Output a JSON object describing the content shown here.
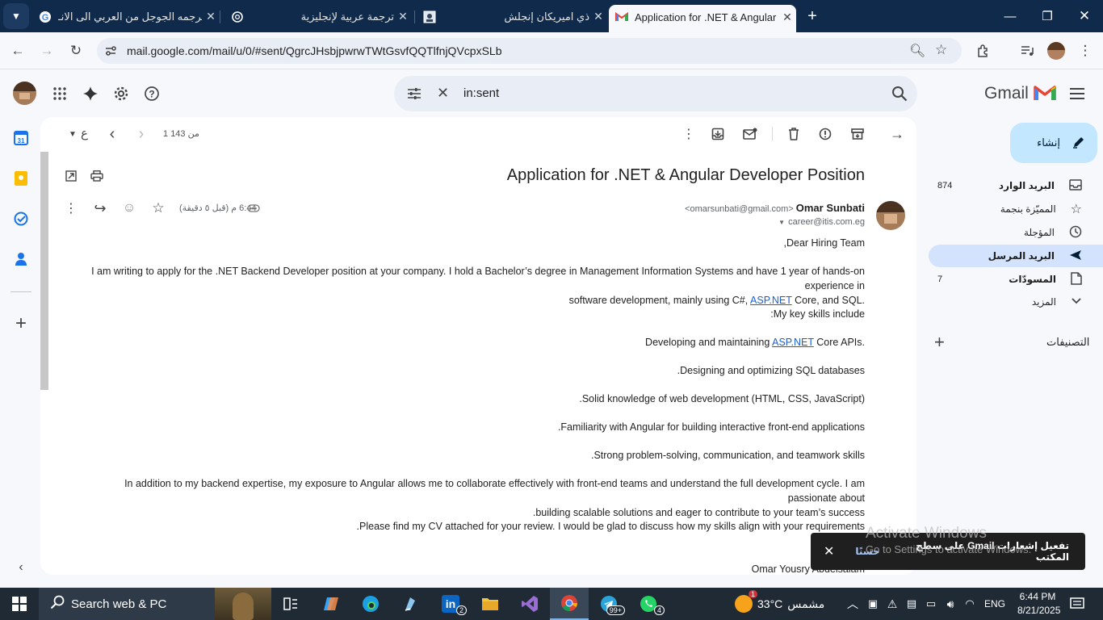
{
  "browser": {
    "tabs": [
      {
        "title": "ترجمه الجوجل من العربي الى الانـ",
        "icon": "google-icon",
        "active": false
      },
      {
        "title": "ترجمة عربية لإنجليزية",
        "icon": "chatgpt-icon",
        "active": false
      },
      {
        "title": "ذي اميريكان إنجلش",
        "icon": "site-icon",
        "active": false
      },
      {
        "title": "Application for .NET & Angular",
        "icon": "gmail-icon",
        "active": true
      }
    ],
    "url": "mail.google.com/mail/u/0/#sent/QgrcJHsbjpwrwTWtGsvfQQTlfnjQVcpxSLb"
  },
  "gmail": {
    "logo_text": "Gmail",
    "search_query": "in:sent",
    "compose_label": "إنشاء",
    "nav": [
      {
        "label": "البريد الوارد",
        "count": "874",
        "icon": "inbox-icon",
        "bold": true
      },
      {
        "label": "المميّزة بنجمة",
        "count": "",
        "icon": "star-icon",
        "bold": false
      },
      {
        "label": "المؤجلة",
        "count": "",
        "icon": "clock-icon",
        "bold": false
      },
      {
        "label": "البريد المرسل",
        "count": "",
        "icon": "send-icon",
        "bold": false,
        "selected": true
      },
      {
        "label": "المسودّات",
        "count": "7",
        "icon": "draft-icon",
        "bold": true
      },
      {
        "label": "المزيد",
        "count": "",
        "icon": "chevron-down-icon",
        "bold": false
      }
    ],
    "labels_heading": "التصنيفات"
  },
  "message": {
    "pagination": "1 من 143",
    "lang_char": "ع",
    "subject": "Application for .NET & Angular Developer Position",
    "sender_name": "Omar Sunbati",
    "sender_email": "<omarsunbati@gmail.com>",
    "recipient": "career@itis.com.eg",
    "time": "6:44 م (قبل ٥ دقيقة)",
    "body": {
      "greeting": "Dear Hiring Team,",
      "p1a": "I am writing to apply for the .NET Backend Developer position at your company. I hold a Bachelor’s degree in Management Information Systems and have 1 year of hands-on experience in",
      "p1b_pre": "software development, mainly using C#, ",
      "link_text": "ASP.NET",
      "p1b_post": " Core, and SQL.",
      "skills_intro": "My key skills include:",
      "skill1_pre": "Developing and maintaining ",
      "skill1_post": " Core APIs.",
      "skill2": "Designing and optimizing SQL databases.",
      "skill3": "Solid knowledge of web development (HTML, CSS, JavaScript).",
      "skill4": "Familiarity with Angular for building interactive front-end applications.",
      "skill5": "Strong problem-solving, communication, and teamwork skills.",
      "p2a": "In addition to my backend expertise, my exposure to Angular allows me to collaborate effectively with front-end teams and understand the full development cycle. I am passionate about",
      "p2b": "building scalable solutions and eager to contribute to your team’s success.",
      "p3": "Please find my CV attached for your review. I would be glad to discuss how my skills align with your requirements.",
      "signature": "Omar Yousry Abdelsalam"
    }
  },
  "toast": {
    "text": "تفعيل إشعارات Gmail على سطح المكتب",
    "action": "حسنًا"
  },
  "watermark": {
    "line1": "Activate Windows",
    "line2": "Go to Settings to activate Windows."
  },
  "taskbar": {
    "search_placeholder": "Search web & PC",
    "weather_temp": "33°C",
    "weather_text": "مشمس",
    "weather_badge": "1",
    "language": "ENG",
    "time": "6:44 PM",
    "date": "8/21/2025",
    "linkedin_badge": "2",
    "telegram_badge": "99+",
    "whatsapp_badge": "4"
  }
}
